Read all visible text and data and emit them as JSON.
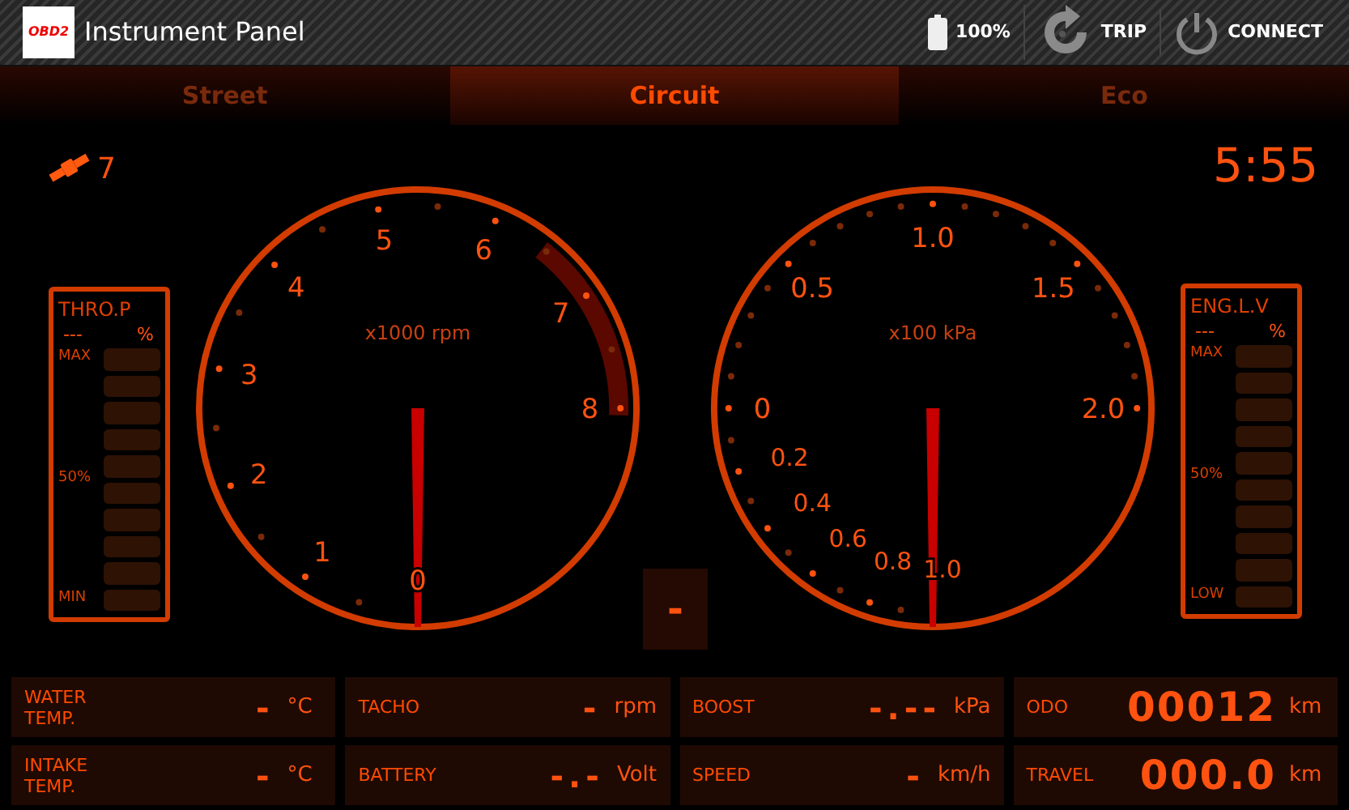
{
  "header": {
    "logo_text": "OBD2",
    "title": "Instrument Panel",
    "actions": [
      {
        "kind": "battery",
        "label": "100%"
      },
      {
        "kind": "trip",
        "label": "TRIP"
      },
      {
        "kind": "connect",
        "label": "CONNECT"
      }
    ]
  },
  "tabs": [
    {
      "label": "Street",
      "selected": false
    },
    {
      "label": "Circuit",
      "selected": true
    },
    {
      "label": "Eco",
      "selected": false
    }
  ],
  "satellites": "7",
  "clock": "5:55",
  "meters": [
    {
      "title": "THRO.P",
      "value": "---",
      "unit": "%",
      "top": "MAX",
      "mid": "50%",
      "bottom": "MIN",
      "level": 0
    },
    {
      "title": "ENG.L.V",
      "value": "---",
      "unit": "%",
      "top": "MAX",
      "mid": "50%",
      "bottom": "LOW",
      "level": 0
    }
  ],
  "tacho": {
    "unit": "x1000 rpm",
    "labels": [
      "0",
      "1",
      "2",
      "3",
      "4",
      "5",
      "6",
      "7",
      "8"
    ]
  },
  "boost": {
    "unit": "x100 kPa",
    "labels": [
      "0",
      "0.5",
      "1.0",
      "1.5",
      "2.0"
    ],
    "vacuum_labels": [
      "0.2",
      "0.4",
      "0.6",
      "0.8",
      "1.0"
    ]
  },
  "center_readout": "-",
  "readings": [
    {
      "kind": "small",
      "label": "WATER\nTEMP.",
      "value": "-",
      "unit": "°C"
    },
    {
      "kind": "small",
      "label": "TACHO",
      "value": "-",
      "unit": "rpm"
    },
    {
      "kind": "small",
      "label": "BOOST",
      "value": "-.--",
      "unit": "kPa"
    },
    {
      "kind": "large",
      "label": "ODO",
      "value": "00012",
      "unit": "km"
    },
    {
      "kind": "small",
      "label": "INTAKE\nTEMP.",
      "value": "-",
      "unit": "°C"
    },
    {
      "kind": "small",
      "label": "BATTERY",
      "value": "-.-",
      "unit": "Volt"
    },
    {
      "kind": "small",
      "label": "SPEED",
      "value": "-",
      "unit": "km/h"
    },
    {
      "kind": "large",
      "label": "TRAVEL",
      "value": "000.0",
      "unit": "km"
    }
  ]
}
